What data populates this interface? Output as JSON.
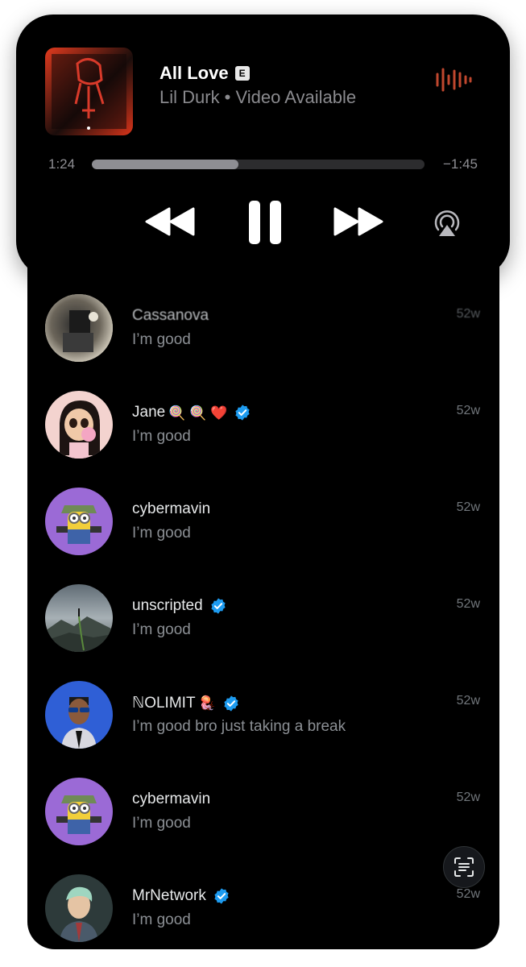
{
  "now_playing": {
    "title": "All Love",
    "explicit_badge": "E",
    "subtitle": "Lil Durk • Video Available",
    "elapsed": "1:24",
    "remaining": "−1:45",
    "progress": 0.44,
    "icons": {
      "waveform": "waveform-icon",
      "rewind": "rewind-icon",
      "pause": "pause-icon",
      "forward": "fast-forward-icon",
      "airplay": "airplay-icon"
    }
  },
  "conversations": [
    {
      "name": "Cassanova",
      "message": "I’m good",
      "time": "52w",
      "verified": false
    },
    {
      "name": "Jane",
      "name_emojis": "🍭 🍭 ❤️",
      "message": "I’m good",
      "time": "52w",
      "verified": true
    },
    {
      "name": "cybermavin",
      "message": "I’m good",
      "time": "52w",
      "verified": false
    },
    {
      "name": "unscripted",
      "message": "I’m good",
      "time": "52w",
      "verified": true
    },
    {
      "name": "ℕOLIMIT",
      "name_emojis": "🪼",
      "message": "I’m good bro just taking a break",
      "time": "52w",
      "verified": true
    },
    {
      "name": "cybermavin",
      "message": "I’m good",
      "time": "52w",
      "verified": false
    },
    {
      "name": "MrNetwork",
      "message": "I’m good",
      "time": "52w",
      "verified": true
    }
  ],
  "colors": {
    "verified": "#1d9bf0",
    "background": "#000000",
    "waveform": "#c0472e"
  }
}
